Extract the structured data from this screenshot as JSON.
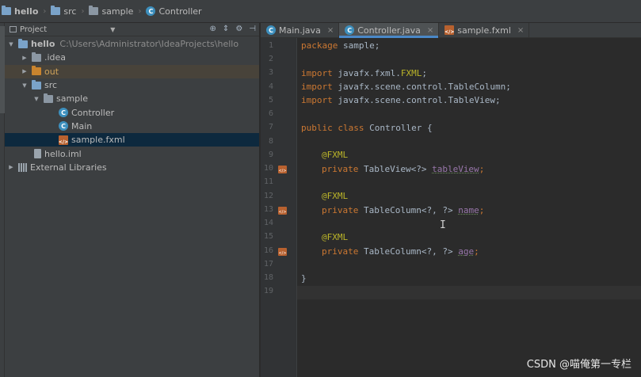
{
  "breadcrumb": {
    "items": [
      {
        "label": "hello",
        "icon": "folder-icon"
      },
      {
        "label": "src",
        "icon": "folder-icon"
      },
      {
        "label": "sample",
        "icon": "package-icon"
      },
      {
        "label": "Controller",
        "icon": "class-icon"
      }
    ]
  },
  "project_panel": {
    "title": "Project",
    "tree": [
      {
        "label": "hello",
        "path": "C:\\Users\\Administrator\\IdeaProjects\\hello",
        "expanded": true
      },
      {
        "label": ".idea"
      },
      {
        "label": "out"
      },
      {
        "label": "src",
        "expanded": true
      },
      {
        "label": "sample",
        "expanded": true
      },
      {
        "label": "Controller"
      },
      {
        "label": "Main"
      },
      {
        "label": "sample.fxml",
        "selected": true
      },
      {
        "label": "hello.iml"
      },
      {
        "label": "External Libraries"
      }
    ]
  },
  "editor": {
    "tabs": [
      {
        "label": "Main.java",
        "icon": "class-icon"
      },
      {
        "label": "Controller.java",
        "icon": "class-icon",
        "active": true
      },
      {
        "label": "sample.fxml",
        "icon": "fxml-icon"
      }
    ],
    "line_numbers": [
      "1",
      "2",
      "3",
      "4",
      "5",
      "6",
      "7",
      "8",
      "9",
      "10",
      "11",
      "12",
      "13",
      "14",
      "15",
      "16",
      "17",
      "18",
      "19"
    ],
    "code": {
      "l1_kw": "package",
      "l1_rest": " sample;",
      "l3_kw": "import",
      "l3_rest": " javafx.fxml.",
      "l3_an": "FXML",
      "l3_end": ";",
      "l4_kw": "import",
      "l4_rest": " javafx.scene.control.TableColumn;",
      "l5_kw": "import",
      "l5_rest": " javafx.scene.control.TableView;",
      "l7_kw": "public class",
      "l7_rest": " Controller {",
      "l9_an": "@FXML",
      "l10_kw": "private",
      "l10_rest": " TableView<?> ",
      "l10_fld": "tableView",
      "l10_end": ";",
      "l12_an": "@FXML",
      "l13_kw": "private",
      "l13_rest": " TableColumn<?, ?> ",
      "l13_fld": "name",
      "l13_end": ";",
      "l15_an": "@FXML",
      "l16_kw": "private",
      "l16_rest": " TableColumn<?, ?> ",
      "l16_fld": "age",
      "l16_end": ";",
      "l18": "}"
    }
  },
  "watermark": "CSDN @喵俺第一专栏",
  "colors": {
    "keyword": "#cc7832",
    "annotation": "#bbb529",
    "field": "#9876aa",
    "selection": "#0d293e",
    "tab_active_underline": "#4a88c7"
  }
}
